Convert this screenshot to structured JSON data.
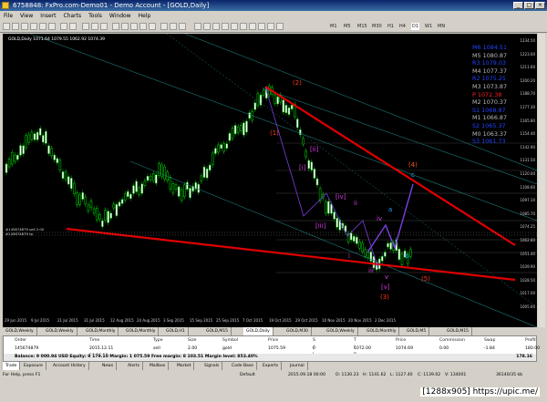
{
  "window": {
    "title": "6758848: FxPro.com-Demo01 - Demo Account - [GOLD,Daily]"
  },
  "menu": [
    "File",
    "View",
    "Insert",
    "Charts",
    "Tools",
    "Window",
    "Help"
  ],
  "timeframes": [
    "M1",
    "M5",
    "M15",
    "M30",
    "H1",
    "H4",
    "D1",
    "W1",
    "MN"
  ],
  "chart": {
    "info": "GOLD,Daily  1071.64 1079.55 1062.92 1074.39",
    "y_ticks": [
      "1234.50",
      "1223.00",
      "1211.60",
      "1200.20",
      "1188.70",
      "1177.30",
      "1165.80",
      "1154.40",
      "1142.90",
      "1131.50",
      "1120.00",
      "1108.60",
      "1097.10",
      "1085.70",
      "1074.25",
      "1062.80",
      "1051.40",
      "1039.90",
      "1028.50",
      "1017.00",
      "1005.60"
    ],
    "x_ticks": [
      "29 Jun 2015",
      "9 Jul 2015",
      "21 Jul 2015",
      "31 Jul 2015",
      "12 Aug 2015",
      "24 Aug 2015",
      "3 Sep 2015",
      "15 Sep 2015",
      "25 Sep 2015",
      "7 Oct 2015",
      "19 Oct 2015",
      "29 Oct 2015",
      "10 Nov 2015",
      "20 Nov 2015",
      "2 Dec 2015"
    ],
    "order_labels": [
      "#145674879 sell 2.00",
      "#145674879 tp"
    ],
    "pivots": [
      {
        "label": "M6",
        "value": "1084.51",
        "color": "#2244ff"
      },
      {
        "label": "M5",
        "value": "1080.87",
        "color": "#bbbbbb"
      },
      {
        "label": "R3",
        "value": "1079.03",
        "color": "#2244ff"
      },
      {
        "label": "M4",
        "value": "1077.37",
        "color": "#bbbbbb"
      },
      {
        "label": "R2",
        "value": "1075.25",
        "color": "#2244ff"
      },
      {
        "label": "M3",
        "value": "1073.87",
        "color": "#bbbbbb"
      },
      {
        "label": "P",
        "value": "1072.38",
        "color": "#ff2222"
      },
      {
        "label": "M2",
        "value": "1070.37",
        "color": "#bbbbbb"
      },
      {
        "label": "S1",
        "value": "1068.87",
        "color": "#2244ff"
      },
      {
        "label": "M1",
        "value": "1066.87",
        "color": "#bbbbbb"
      },
      {
        "label": "S2",
        "value": "1065.37",
        "color": "#2244ff"
      },
      {
        "label": "M0",
        "value": "1063.37",
        "color": "#bbbbbb"
      },
      {
        "label": "S3",
        "value": "1061.73",
        "color": "#2244ff"
      }
    ],
    "waves": {
      "w1": "(1)",
      "w2": "(2)",
      "w3": "(3)",
      "w4": "(4)",
      "w5": "(5)",
      "i": "i",
      "ii": "ii",
      "iii": "iii",
      "iv": "iv",
      "v": "v",
      "bi": "[i]",
      "bii": "[ii]",
      "biii": "[iii]",
      "biv": "[iv]",
      "bv": "[v]",
      "a": "a",
      "b": "b",
      "c": "c"
    }
  },
  "chart_tabs": [
    "GOLD,Weekly",
    "GOLD,Weekly",
    "GOLD,Monthly",
    "GOLD,Monthly",
    "GOLD,H1",
    "GOLD,M15",
    "GOLD,Daily",
    "GOLD,M30",
    "GOLD,Weekly",
    "GOLD,Monthly",
    "GOLD,M5",
    "GOLD,M15"
  ],
  "terminal": {
    "headers": [
      "Order",
      "Time",
      "Type",
      "Size",
      "Symbol",
      "Price",
      "S / L",
      "T / P",
      "Price",
      "Commission",
      "Swap",
      "Profit"
    ],
    "row": [
      "145674879",
      "2015.12.11 20:30:11",
      "sell",
      "2.00",
      "gold",
      "1075.59",
      "0",
      "1072.00",
      "1074.69",
      "0.00",
      "-1.84",
      "180.00"
    ],
    "balance": "Balance: 9 000.94 USD  Equity: 9 179.10  Margin: 1 075.59  Free margin: 8 103.51  Margin level: 853.40%",
    "balance_total": "178.16",
    "tabs": [
      "Trade",
      "Exposure",
      "Account History",
      "News",
      "Alerts",
      "Mailbox",
      "Market",
      "Signals",
      "Code Base",
      "Experts",
      "Journal"
    ]
  },
  "status": {
    "help": "For Help, press F1",
    "profile": "Default",
    "datetime": "2015.09.18 00:00",
    "open": "O: 1130.23",
    "high": "H: 1141.62",
    "low": "L: 1127.40",
    "close": "C: 1139.02",
    "volume": "V: 134001",
    "traffic": "36140/35 kb"
  },
  "watermark": "[1288x905] https://upic.me/"
}
